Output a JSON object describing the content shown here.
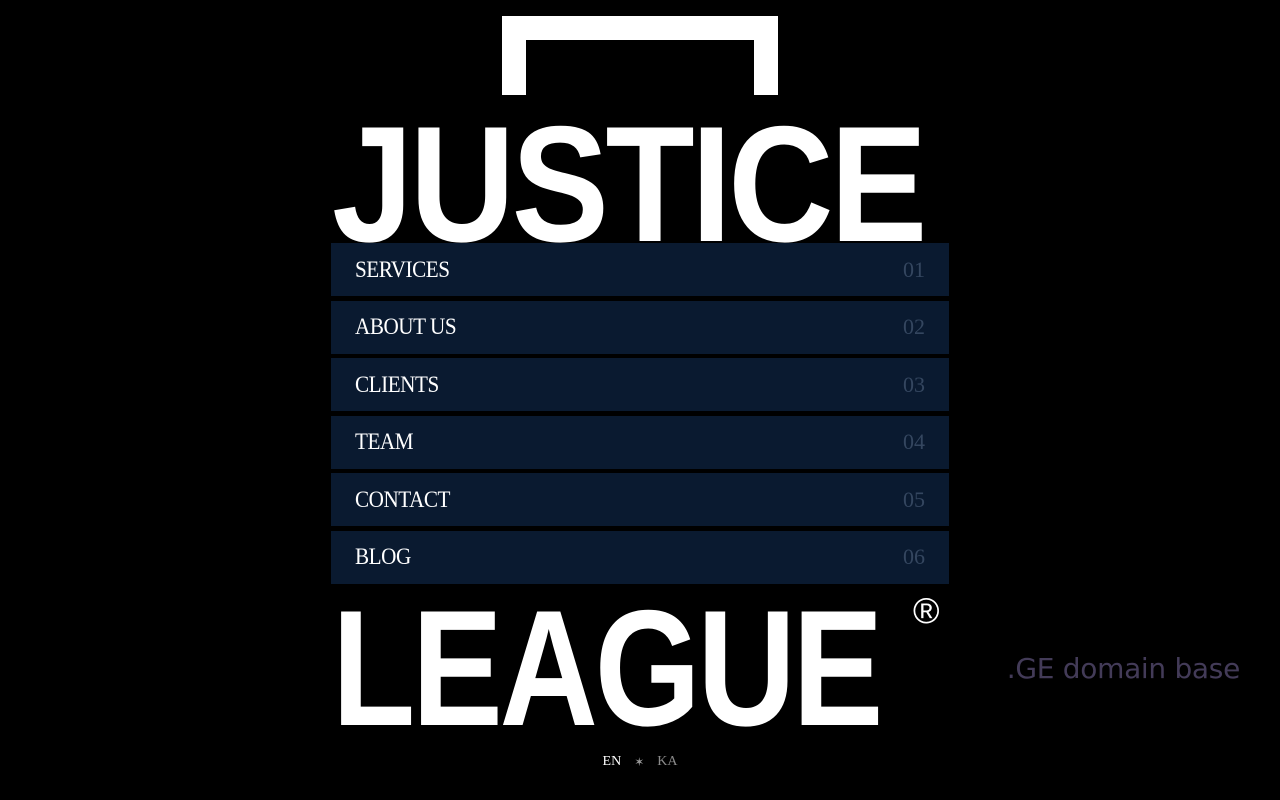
{
  "brand": {
    "word_top": "JUSTICE",
    "word_bottom": "LEAGUE",
    "registered_mark": "®",
    "logo_color": "#ffffff"
  },
  "menu": {
    "items": [
      {
        "label": "SERVICES",
        "number": "01"
      },
      {
        "label": "ABOUT US",
        "number": "02"
      },
      {
        "label": "CLIENTS",
        "number": "03"
      },
      {
        "label": "TEAM",
        "number": "04"
      },
      {
        "label": "CONTACT",
        "number": "05"
      },
      {
        "label": "BLOG",
        "number": "06"
      }
    ],
    "item_background": "#0a1a30",
    "number_color": "#34465f"
  },
  "domain_note": ".GE domain base",
  "language": {
    "current": "EN",
    "separator": "✶",
    "alternate": "KA"
  },
  "colors": {
    "background": "#000000",
    "domain_note": "#433b58"
  }
}
